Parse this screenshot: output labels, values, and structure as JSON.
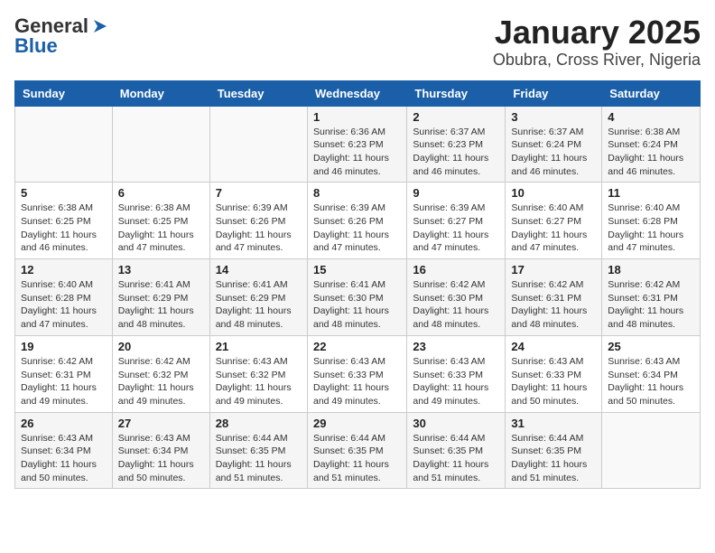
{
  "logo": {
    "line1": "General",
    "line2": "Blue"
  },
  "title": "January 2025",
  "subtitle": "Obubra, Cross River, Nigeria",
  "days_of_week": [
    "Sunday",
    "Monday",
    "Tuesday",
    "Wednesday",
    "Thursday",
    "Friday",
    "Saturday"
  ],
  "weeks": [
    [
      {
        "day": "",
        "info": ""
      },
      {
        "day": "",
        "info": ""
      },
      {
        "day": "",
        "info": ""
      },
      {
        "day": "1",
        "info": "Sunrise: 6:36 AM\nSunset: 6:23 PM\nDaylight: 11 hours\nand 46 minutes."
      },
      {
        "day": "2",
        "info": "Sunrise: 6:37 AM\nSunset: 6:23 PM\nDaylight: 11 hours\nand 46 minutes."
      },
      {
        "day": "3",
        "info": "Sunrise: 6:37 AM\nSunset: 6:24 PM\nDaylight: 11 hours\nand 46 minutes."
      },
      {
        "day": "4",
        "info": "Sunrise: 6:38 AM\nSunset: 6:24 PM\nDaylight: 11 hours\nand 46 minutes."
      }
    ],
    [
      {
        "day": "5",
        "info": "Sunrise: 6:38 AM\nSunset: 6:25 PM\nDaylight: 11 hours\nand 46 minutes."
      },
      {
        "day": "6",
        "info": "Sunrise: 6:38 AM\nSunset: 6:25 PM\nDaylight: 11 hours\nand 47 minutes."
      },
      {
        "day": "7",
        "info": "Sunrise: 6:39 AM\nSunset: 6:26 PM\nDaylight: 11 hours\nand 47 minutes."
      },
      {
        "day": "8",
        "info": "Sunrise: 6:39 AM\nSunset: 6:26 PM\nDaylight: 11 hours\nand 47 minutes."
      },
      {
        "day": "9",
        "info": "Sunrise: 6:39 AM\nSunset: 6:27 PM\nDaylight: 11 hours\nand 47 minutes."
      },
      {
        "day": "10",
        "info": "Sunrise: 6:40 AM\nSunset: 6:27 PM\nDaylight: 11 hours\nand 47 minutes."
      },
      {
        "day": "11",
        "info": "Sunrise: 6:40 AM\nSunset: 6:28 PM\nDaylight: 11 hours\nand 47 minutes."
      }
    ],
    [
      {
        "day": "12",
        "info": "Sunrise: 6:40 AM\nSunset: 6:28 PM\nDaylight: 11 hours\nand 47 minutes."
      },
      {
        "day": "13",
        "info": "Sunrise: 6:41 AM\nSunset: 6:29 PM\nDaylight: 11 hours\nand 48 minutes."
      },
      {
        "day": "14",
        "info": "Sunrise: 6:41 AM\nSunset: 6:29 PM\nDaylight: 11 hours\nand 48 minutes."
      },
      {
        "day": "15",
        "info": "Sunrise: 6:41 AM\nSunset: 6:30 PM\nDaylight: 11 hours\nand 48 minutes."
      },
      {
        "day": "16",
        "info": "Sunrise: 6:42 AM\nSunset: 6:30 PM\nDaylight: 11 hours\nand 48 minutes."
      },
      {
        "day": "17",
        "info": "Sunrise: 6:42 AM\nSunset: 6:31 PM\nDaylight: 11 hours\nand 48 minutes."
      },
      {
        "day": "18",
        "info": "Sunrise: 6:42 AM\nSunset: 6:31 PM\nDaylight: 11 hours\nand 48 minutes."
      }
    ],
    [
      {
        "day": "19",
        "info": "Sunrise: 6:42 AM\nSunset: 6:31 PM\nDaylight: 11 hours\nand 49 minutes."
      },
      {
        "day": "20",
        "info": "Sunrise: 6:42 AM\nSunset: 6:32 PM\nDaylight: 11 hours\nand 49 minutes."
      },
      {
        "day": "21",
        "info": "Sunrise: 6:43 AM\nSunset: 6:32 PM\nDaylight: 11 hours\nand 49 minutes."
      },
      {
        "day": "22",
        "info": "Sunrise: 6:43 AM\nSunset: 6:33 PM\nDaylight: 11 hours\nand 49 minutes."
      },
      {
        "day": "23",
        "info": "Sunrise: 6:43 AM\nSunset: 6:33 PM\nDaylight: 11 hours\nand 49 minutes."
      },
      {
        "day": "24",
        "info": "Sunrise: 6:43 AM\nSunset: 6:33 PM\nDaylight: 11 hours\nand 50 minutes."
      },
      {
        "day": "25",
        "info": "Sunrise: 6:43 AM\nSunset: 6:34 PM\nDaylight: 11 hours\nand 50 minutes."
      }
    ],
    [
      {
        "day": "26",
        "info": "Sunrise: 6:43 AM\nSunset: 6:34 PM\nDaylight: 11 hours\nand 50 minutes."
      },
      {
        "day": "27",
        "info": "Sunrise: 6:43 AM\nSunset: 6:34 PM\nDaylight: 11 hours\nand 50 minutes."
      },
      {
        "day": "28",
        "info": "Sunrise: 6:44 AM\nSunset: 6:35 PM\nDaylight: 11 hours\nand 51 minutes."
      },
      {
        "day": "29",
        "info": "Sunrise: 6:44 AM\nSunset: 6:35 PM\nDaylight: 11 hours\nand 51 minutes."
      },
      {
        "day": "30",
        "info": "Sunrise: 6:44 AM\nSunset: 6:35 PM\nDaylight: 11 hours\nand 51 minutes."
      },
      {
        "day": "31",
        "info": "Sunrise: 6:44 AM\nSunset: 6:35 PM\nDaylight: 11 hours\nand 51 minutes."
      },
      {
        "day": "",
        "info": ""
      }
    ]
  ]
}
